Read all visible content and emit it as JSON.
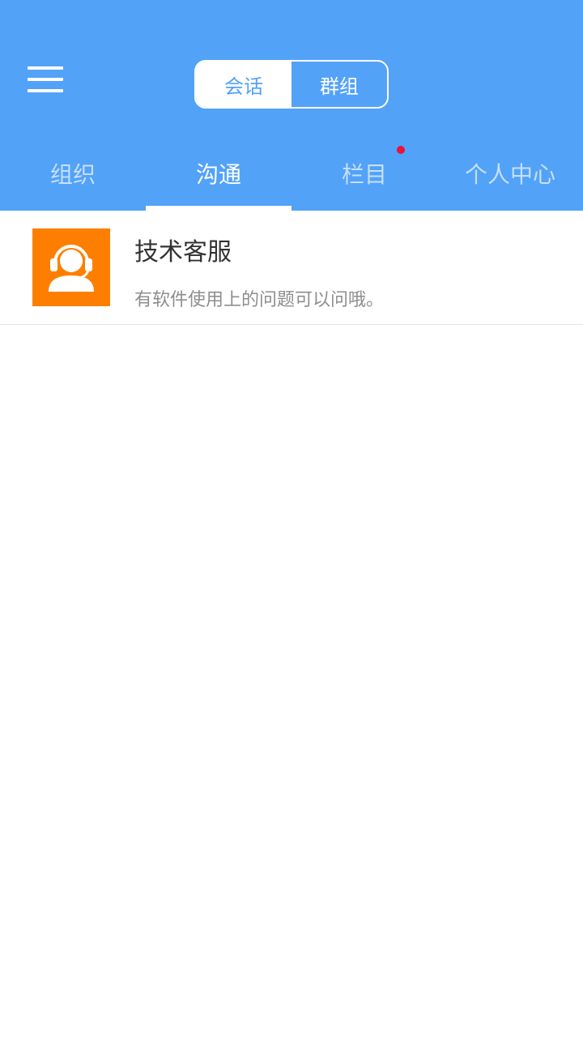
{
  "header": {
    "segment": {
      "options": [
        "会话",
        "群组"
      ],
      "selected": "会话"
    },
    "tabs": [
      {
        "label": "组织",
        "active": false,
        "badge": false
      },
      {
        "label": "沟通",
        "active": true,
        "badge": false
      },
      {
        "label": "栏目",
        "active": false,
        "badge": true
      },
      {
        "label": "个人中心",
        "active": false,
        "badge": false
      }
    ]
  },
  "conversations": [
    {
      "title": "技术客服",
      "subtitle": "有软件使用上的问题可以问哦。",
      "avatar_icon": "headset-user-icon"
    }
  ],
  "colors": {
    "header_bg": "#52a2f8",
    "badge": "#e8123a",
    "avatar_bg": "#fe7f00"
  }
}
